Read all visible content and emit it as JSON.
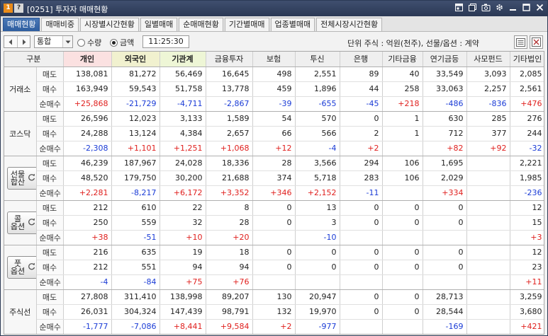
{
  "window": {
    "badge1": "1",
    "badge2": "?",
    "title": "[0251] 투자자 매매현황",
    "icons": [
      "window-restore-icon",
      "copy-icon",
      "camera-icon",
      "gear-icon",
      "minimize-icon",
      "maximize-icon",
      "close-icon"
    ]
  },
  "tabs": [
    "매매현황",
    "매매비중",
    "시장별시간현황",
    "일별매매",
    "순매매현황",
    "기간별매매",
    "업종별매매",
    "전체시장시간현황"
  ],
  "active_tab_index": 0,
  "toolbar": {
    "combo_value": "통합",
    "radio_quantity": "수량",
    "radio_amount": "금액",
    "selected_radio": "금액",
    "time": "11:25:30",
    "unit_text": "단위 주식 : 억원(천주), 선물/옵션 : 계약"
  },
  "colors": {
    "up": "#e0201e",
    "down": "#1a3bd6",
    "title_bar": "#2b3954",
    "active_tab": "#2e5e9f"
  },
  "table": {
    "header_group": "구분",
    "columns": [
      "개인",
      "외국인",
      "기관계",
      "금융투자",
      "보험",
      "투신",
      "은행",
      "기타금융",
      "연기금등",
      "사모펀드",
      "기타법인"
    ],
    "row_labels": [
      "매도",
      "매수",
      "순매수"
    ],
    "markets": [
      {
        "name": "거래소",
        "button": false,
        "rows": [
          [
            "138,081",
            "81,272",
            "56,469",
            "16,645",
            "498",
            "2,551",
            "89",
            "40",
            "33,549",
            "3,093",
            "2,085"
          ],
          [
            "163,949",
            "59,543",
            "51,758",
            "13,778",
            "459",
            "1,896",
            "44",
            "258",
            "33,063",
            "2,257",
            "2,561"
          ],
          [
            "+25,868",
            "-21,729",
            "-4,711",
            "-2,867",
            "-39",
            "-655",
            "-45",
            "+218",
            "-486",
            "-836",
            "+476"
          ]
        ]
      },
      {
        "name": "코스닥",
        "button": false,
        "rows": [
          [
            "26,596",
            "12,023",
            "3,133",
            "1,589",
            "54",
            "570",
            "0",
            "1",
            "630",
            "285",
            "276"
          ],
          [
            "24,288",
            "13,124",
            "4,384",
            "2,657",
            "66",
            "566",
            "2",
            "1",
            "712",
            "377",
            "244"
          ],
          [
            "-2,308",
            "+1,101",
            "+1,251",
            "+1,068",
            "+12",
            "-4",
            "+2",
            "",
            "+82",
            "+92",
            "-32"
          ]
        ]
      },
      {
        "name": "선물합산",
        "button": true,
        "label_lines": [
          "선물",
          "합산"
        ],
        "rows": [
          [
            "46,239",
            "187,967",
            "24,028",
            "18,336",
            "28",
            "3,566",
            "294",
            "106",
            "1,695",
            "",
            "2,221"
          ],
          [
            "48,520",
            "179,750",
            "30,200",
            "21,688",
            "374",
            "5,718",
            "283",
            "106",
            "2,029",
            "",
            "1,985"
          ],
          [
            "+2,281",
            "-8,217",
            "+6,172",
            "+3,352",
            "+346",
            "+2,152",
            "-11",
            "",
            "+334",
            "",
            "-236"
          ]
        ]
      },
      {
        "name": "콜옵션",
        "button": true,
        "label_lines": [
          "콜",
          "옵션"
        ],
        "rows": [
          [
            "212",
            "610",
            "22",
            "8",
            "0",
            "13",
            "0",
            "0",
            "0",
            "",
            "12"
          ],
          [
            "250",
            "559",
            "32",
            "28",
            "0",
            "3",
            "0",
            "0",
            "0",
            "",
            "15"
          ],
          [
            "+38",
            "-51",
            "+10",
            "+20",
            "",
            "-10",
            "",
            "",
            "",
            "",
            "+3"
          ]
        ]
      },
      {
        "name": "풋옵션",
        "button": true,
        "label_lines": [
          "풋",
          "옵션"
        ],
        "rows": [
          [
            "216",
            "635",
            "19",
            "18",
            "0",
            "0",
            "0",
            "0",
            "0",
            "",
            "12"
          ],
          [
            "212",
            "551",
            "94",
            "94",
            "0",
            "0",
            "0",
            "0",
            "0",
            "",
            "23"
          ],
          [
            "-4",
            "-84",
            "+75",
            "+76",
            "",
            "",
            "",
            "",
            "",
            "",
            "+11"
          ]
        ]
      },
      {
        "name": "주식선",
        "button": false,
        "rows": [
          [
            "27,808",
            "311,410",
            "138,998",
            "89,207",
            "130",
            "20,947",
            "0",
            "0",
            "28,713",
            "",
            "3,259"
          ],
          [
            "26,031",
            "304,324",
            "147,439",
            "98,791",
            "132",
            "19,970",
            "0",
            "0",
            "28,544",
            "",
            "3,680"
          ],
          [
            "-1,777",
            "-7,086",
            "+8,441",
            "+9,584",
            "+2",
            "-977",
            "",
            "",
            "-169",
            "",
            "+421"
          ]
        ]
      }
    ]
  }
}
